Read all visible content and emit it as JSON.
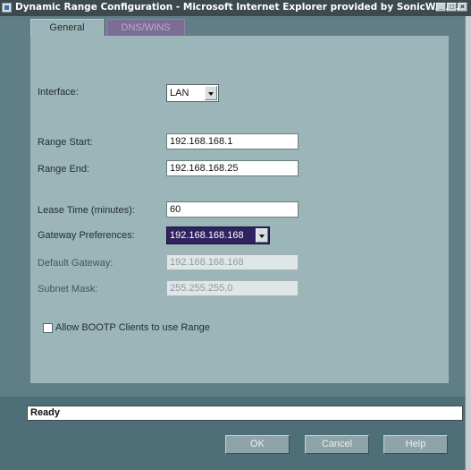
{
  "window": {
    "title": "Dynamic Range Configuration - Microsoft Internet Explorer provided by SonicWAL...",
    "controls": [
      "minimize",
      "maximize",
      "close"
    ]
  },
  "tabs": [
    {
      "label": "General",
      "active": true
    },
    {
      "label": "DNS/WINS",
      "active": false
    }
  ],
  "form": {
    "interface": {
      "label": "Interface:",
      "value": "LAN"
    },
    "range_start": {
      "label": "Range Start:",
      "value": "192.168.168.1"
    },
    "range_end": {
      "label": "Range End:",
      "value": "192.168.168.25"
    },
    "lease_time": {
      "label": "Lease Time (minutes):",
      "value": "60"
    },
    "gateway_preferences": {
      "label": "Gateway Preferences:",
      "value": "192.168.168.168"
    },
    "default_gateway": {
      "label": "Default Gateway:",
      "value": "192.168.168.168",
      "disabled": true
    },
    "subnet_mask": {
      "label": "Subnet Mask:",
      "value": "255.255.255.0",
      "disabled": true
    },
    "bootp": {
      "label": "Allow BOOTP Clients to use Range",
      "checked": false
    }
  },
  "status": {
    "text": "Ready"
  },
  "buttons": {
    "ok": "OK",
    "cancel": "Cancel",
    "help": "Help"
  },
  "colors": {
    "background": "#5f7e86",
    "panel": "#9cb5b9",
    "inactive_tab": "#7c6d96",
    "select_highlight": "#30215f",
    "titlebar": "#3c4a4f"
  }
}
